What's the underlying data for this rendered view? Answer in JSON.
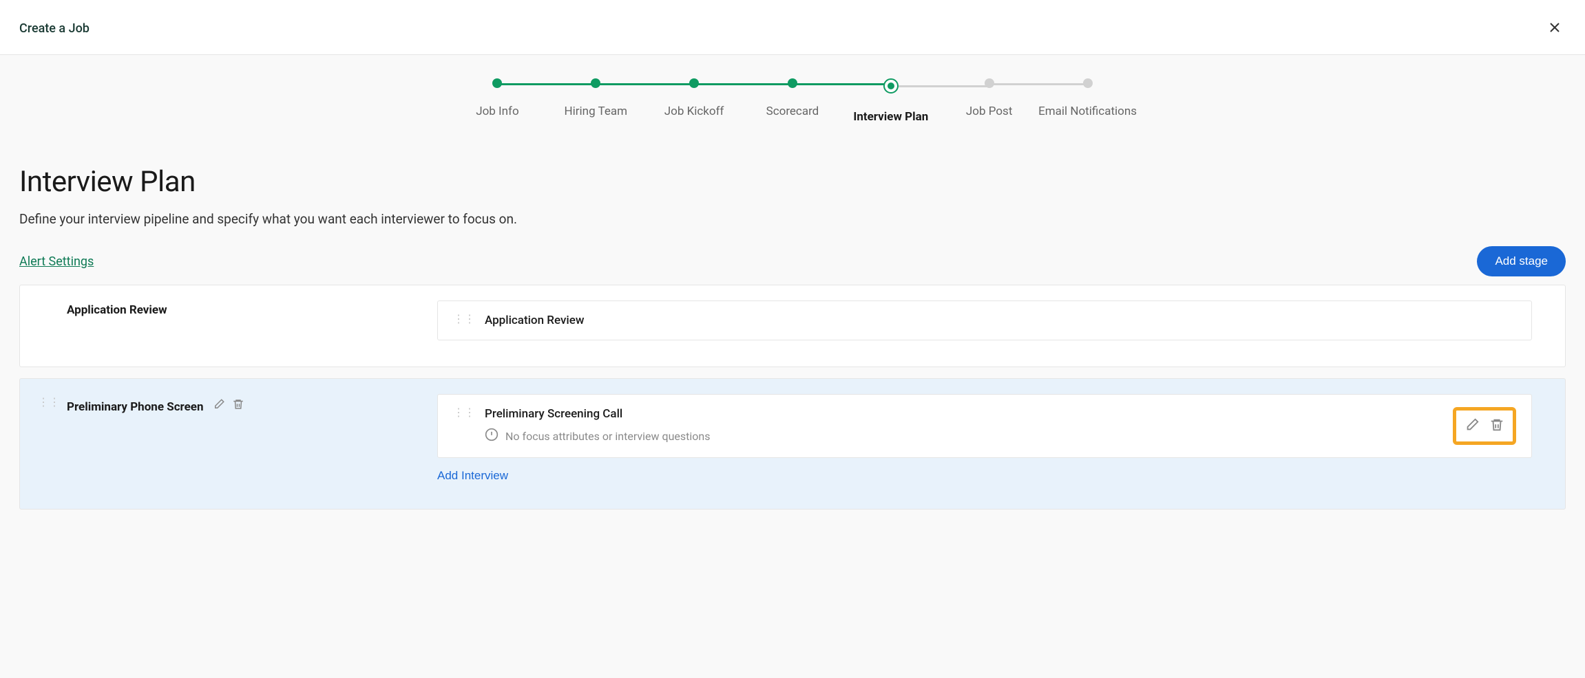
{
  "header": {
    "title": "Create a Job"
  },
  "steps": [
    {
      "label": "Job Info",
      "state": "completed"
    },
    {
      "label": "Hiring Team",
      "state": "completed"
    },
    {
      "label": "Job Kickoff",
      "state": "completed"
    },
    {
      "label": "Scorecard",
      "state": "completed"
    },
    {
      "label": "Interview Plan",
      "state": "current"
    },
    {
      "label": "Job Post",
      "state": "upcoming"
    },
    {
      "label": "Email Notifications",
      "state": "upcoming"
    }
  ],
  "page": {
    "title": "Interview Plan",
    "description": "Define your interview pipeline and specify what you want each interviewer to focus on.",
    "alert_link": "Alert Settings",
    "add_stage": "Add stage",
    "add_interview": "Add Interview"
  },
  "stages": [
    {
      "name": "Application Review",
      "highlighted": false,
      "show_stage_actions": false,
      "interviews": [
        {
          "title": "Application Review",
          "warning": null,
          "show_actions": false
        }
      ]
    },
    {
      "name": "Preliminary Phone Screen",
      "highlighted": true,
      "show_stage_actions": true,
      "interviews": [
        {
          "title": "Preliminary Screening Call",
          "warning": "No focus attributes or interview questions",
          "show_actions": true
        }
      ]
    }
  ]
}
